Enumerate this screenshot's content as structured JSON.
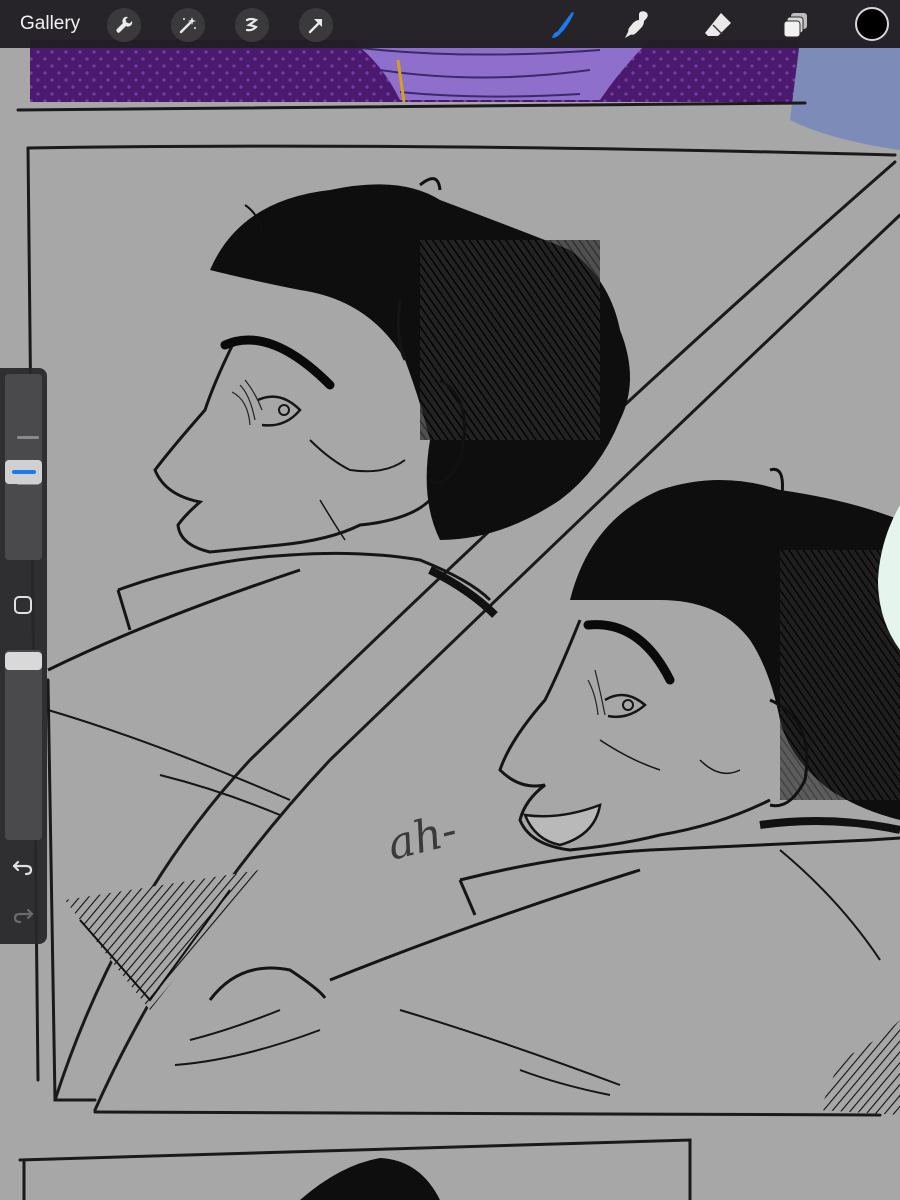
{
  "toolbar": {
    "gallery_label": "Gallery",
    "left_tools": [
      "wrench-icon",
      "magic-wand-icon",
      "selection-icon",
      "transform-arrow-icon"
    ],
    "right_tools": [
      "brush-icon",
      "smudge-icon",
      "eraser-icon",
      "layers-icon"
    ],
    "active_tool": "brush-icon",
    "active_color": "#000000",
    "accent_color": "#1a7cf0"
  },
  "sidebar": {
    "brush_size_level": 0.47,
    "opacity_level": 0.0,
    "controls": [
      "brush-size-slider",
      "modify-button",
      "opacity-slider",
      "undo-icon",
      "redo-icon"
    ]
  },
  "canvas": {
    "background": "#a7a7a7",
    "handwritten_text": "ah-"
  }
}
